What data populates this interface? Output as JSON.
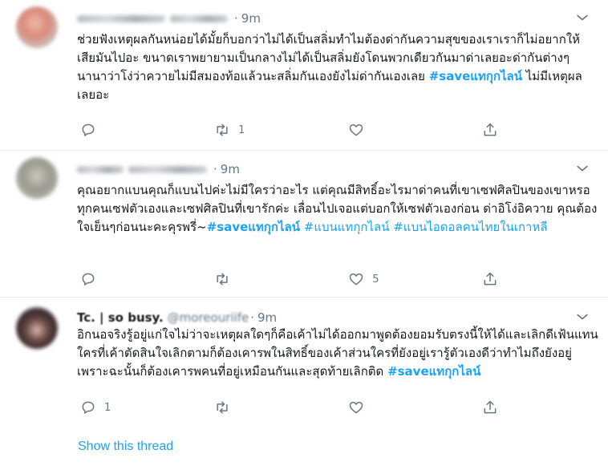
{
  "tweets": [
    {
      "time": "9m",
      "text": "ช่วยฟังเหตุผลกันหน่อยได้มั้ยก็บอกว่าไม่ได้เป็นสลิ่มทำไมต้องด่ากันความสุขของเราเราก็ไม่อยากให้เสียมันไปอะ ขนาดเราพยายามเป็นกลางไม่ได้เป็นสลิ่มยังโดนพวกเดียวกันมาด่าเลยอะด่ากันต่างๆนานาว่าโง่ว่าควายไม่มีสมองท้อแล้วนะสลิ่มกันเองยังไม่ด่ากันเองเลย ",
      "hashtag": "#saveแทกุกไลน์",
      "text_after": " ไม่มีเหตุผลเลยอะ",
      "reply_count": "",
      "retweet_count": "1",
      "like_count": ""
    },
    {
      "time": "9m",
      "text": "คุณอยากแบนคุณก็แบนไปค่ะไม่มีใครว่าอะไร แต่คุณมีสิทธิ์อะไรมาด่าคนที่เขาเซฟศิลปินของเขาหรอ ทุกคนเซฟตัวเองและเซฟศิลปินที่เขารักค่ะ เลื่อนไปเจอแต่บอกให้เซฟตัวเองก่อน ด่าอิโง่อิควาย คุณต้องใจเย็นๆก่อนนะคะคุรพรี่~",
      "hashtag": "#saveแทกุกไลน์",
      "hashtags_after": " #แบนแทกุกไลน์ #แบนไอดอลคนไทยในเกาหลี",
      "reply_count": "",
      "retweet_count": "",
      "like_count": "5"
    },
    {
      "name": "Tc. | so busy.",
      "handle": "@moreouriife",
      "time": "9m",
      "text": "อิกนอจริงรู้อยู่แก่ใจไม่ว่าจะเหตุผลใดๆก็คือเค้าไม่ได้ออกมาพูดต้องยอมรับตรงนี้ให้ได้และเลิกดีเฟ้นแทน ใครที่เค้าตัดสินใจเลิกตามก็ต้องเคารพในสิทธิ์ของเค้าส่วนใครที่ยังอยู่เรารู้ตัวเองดีว่าทำไมถึงยังอยู่เพราะฉะนั้นก็ต้องเคารพคนที่อยู่เหมือนกันและสุดท้ายเลิกติด ",
      "hashtag": "#saveแทกุกไลน์",
      "reply_count": "1",
      "retweet_count": "",
      "like_count": "",
      "show_thread": "Show this thread"
    }
  ],
  "icons": {
    "reply": "reply-icon",
    "retweet": "retweet-icon",
    "like": "heart-icon",
    "share": "share-icon",
    "caret": "chevron-down-icon"
  },
  "colors": {
    "link": "#1da1f2",
    "meta": "#657786",
    "text": "#14171a",
    "divider": "#e6ecf0"
  }
}
